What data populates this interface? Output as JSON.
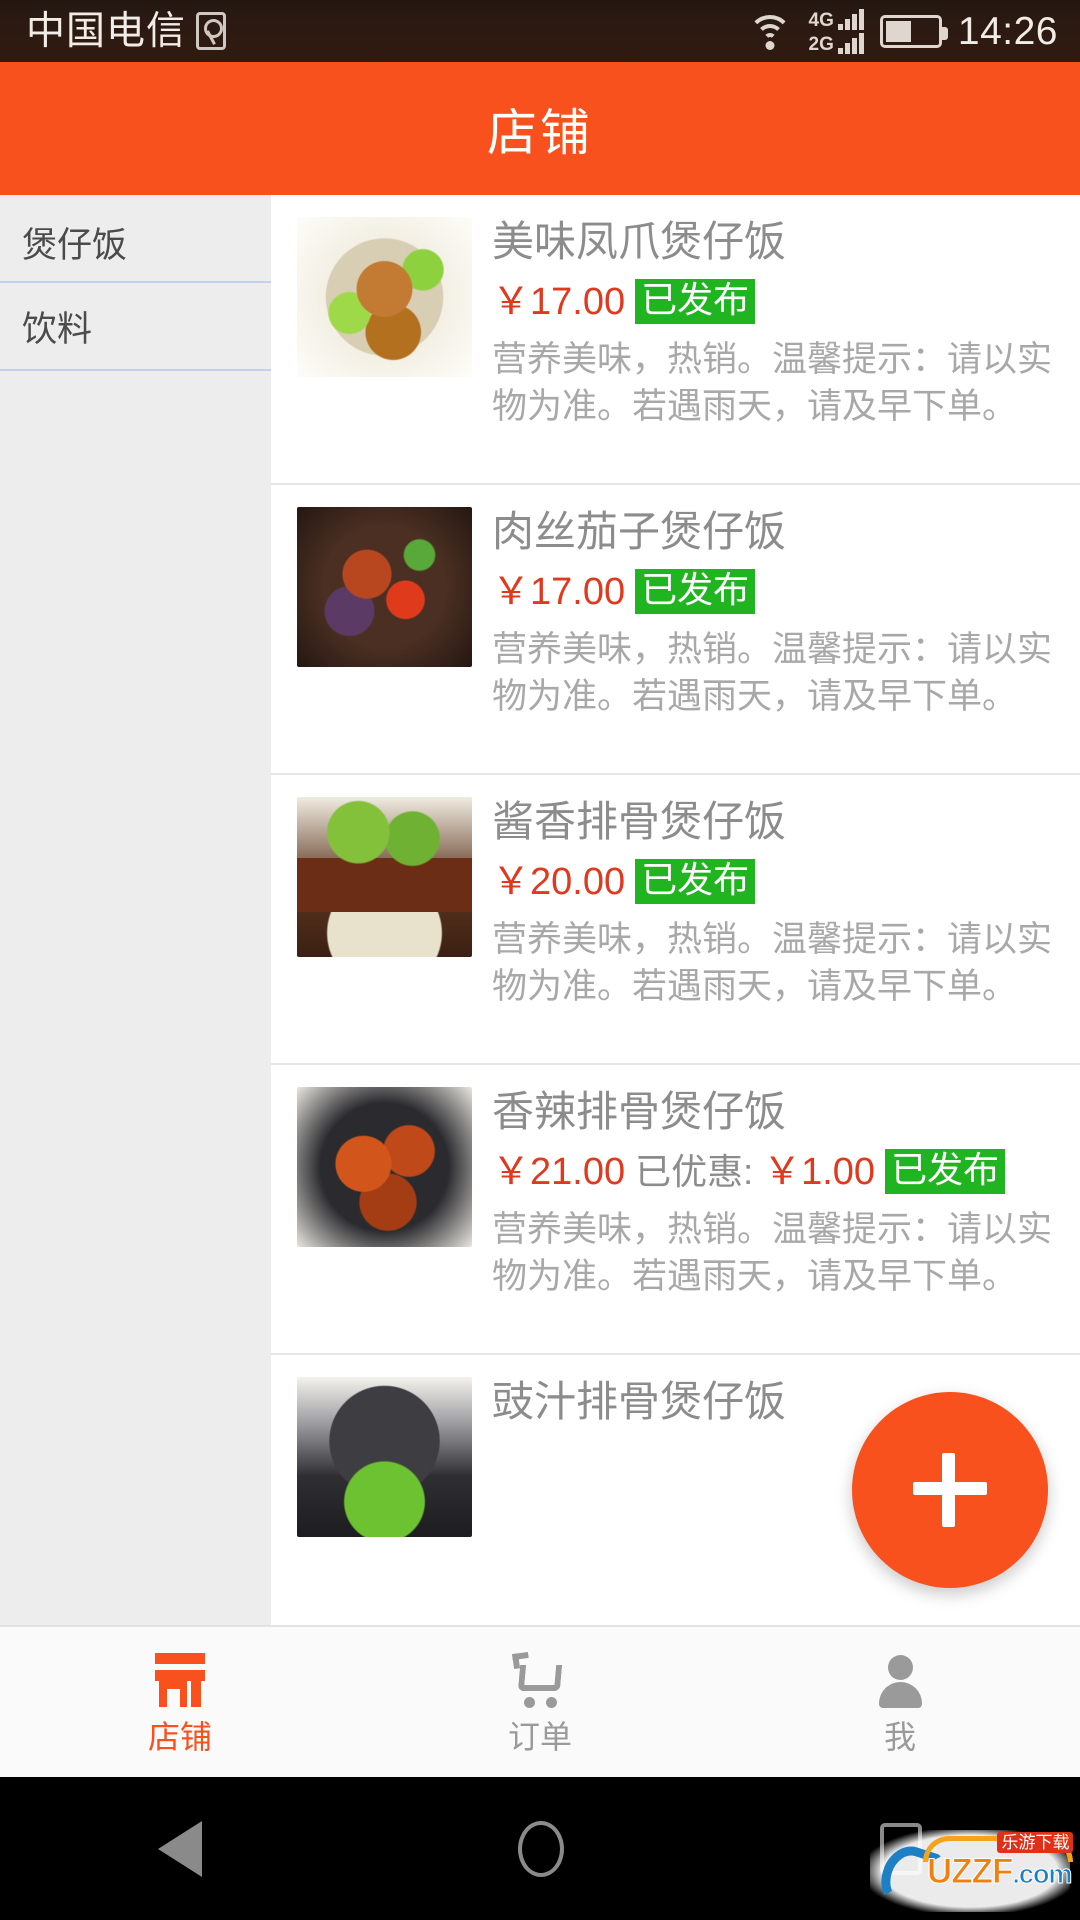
{
  "status_bar": {
    "carrier": "中国电信",
    "sim_icon": "sim-card-icon",
    "wifi_icon": "wifi-icon",
    "signal_primary": "4G",
    "signal_secondary": "2G",
    "battery_icon": "battery-icon",
    "time": "14:26"
  },
  "header": {
    "title": "店铺"
  },
  "sidebar": {
    "categories": [
      {
        "label": "煲仔饭"
      },
      {
        "label": "饮料"
      }
    ]
  },
  "product_list": {
    "items": [
      {
        "name": "美味凤爪煲仔饭",
        "price": "￥17.00",
        "promo_label": "",
        "promo_value": "",
        "status": "已发布",
        "description": "营养美味，热销。温馨提示：请以实物为准。若遇雨天，请及早下单。"
      },
      {
        "name": "肉丝茄子煲仔饭",
        "price": "￥17.00",
        "promo_label": "",
        "promo_value": "",
        "status": "已发布",
        "description": "营养美味，热销。温馨提示：请以实物为准。若遇雨天，请及早下单。"
      },
      {
        "name": "酱香排骨煲仔饭",
        "price": "￥20.00",
        "promo_label": "",
        "promo_value": "",
        "status": "已发布",
        "description": "营养美味，热销。温馨提示：请以实物为准。若遇雨天，请及早下单。"
      },
      {
        "name": "香辣排骨煲仔饭",
        "price": "￥21.00",
        "promo_label": "已优惠:",
        "promo_value": "￥1.00",
        "status": "已发布",
        "description": "营养美味，热销。温馨提示：请以实物为准。若遇雨天，请及早下单。"
      },
      {
        "name": "豉汁排骨煲仔饭",
        "price": "",
        "promo_label": "",
        "promo_value": "",
        "status": "",
        "description": ""
      }
    ]
  },
  "fab": {
    "icon": "plus-icon",
    "label": "+"
  },
  "tab_bar": {
    "tabs": [
      {
        "label": "店铺",
        "icon": "store-icon",
        "active": true
      },
      {
        "label": "订单",
        "icon": "cart-icon",
        "active": false
      },
      {
        "label": "我",
        "icon": "person-icon",
        "active": false
      }
    ]
  },
  "android_nav": {
    "back_icon": "back-triangle-icon",
    "home_icon": "home-circle-icon",
    "recents_icon": "recents-square-icon"
  },
  "watermark": {
    "brand": "UZZF",
    "domain": ".com",
    "tagline": "乐游下载"
  },
  "colors": {
    "accent": "#f9511d",
    "price": "#e0391e",
    "badge": "#20b520",
    "sidebar_bg": "#ededed",
    "divider": "#c6cfe8",
    "text_muted": "#a8a8a8"
  }
}
